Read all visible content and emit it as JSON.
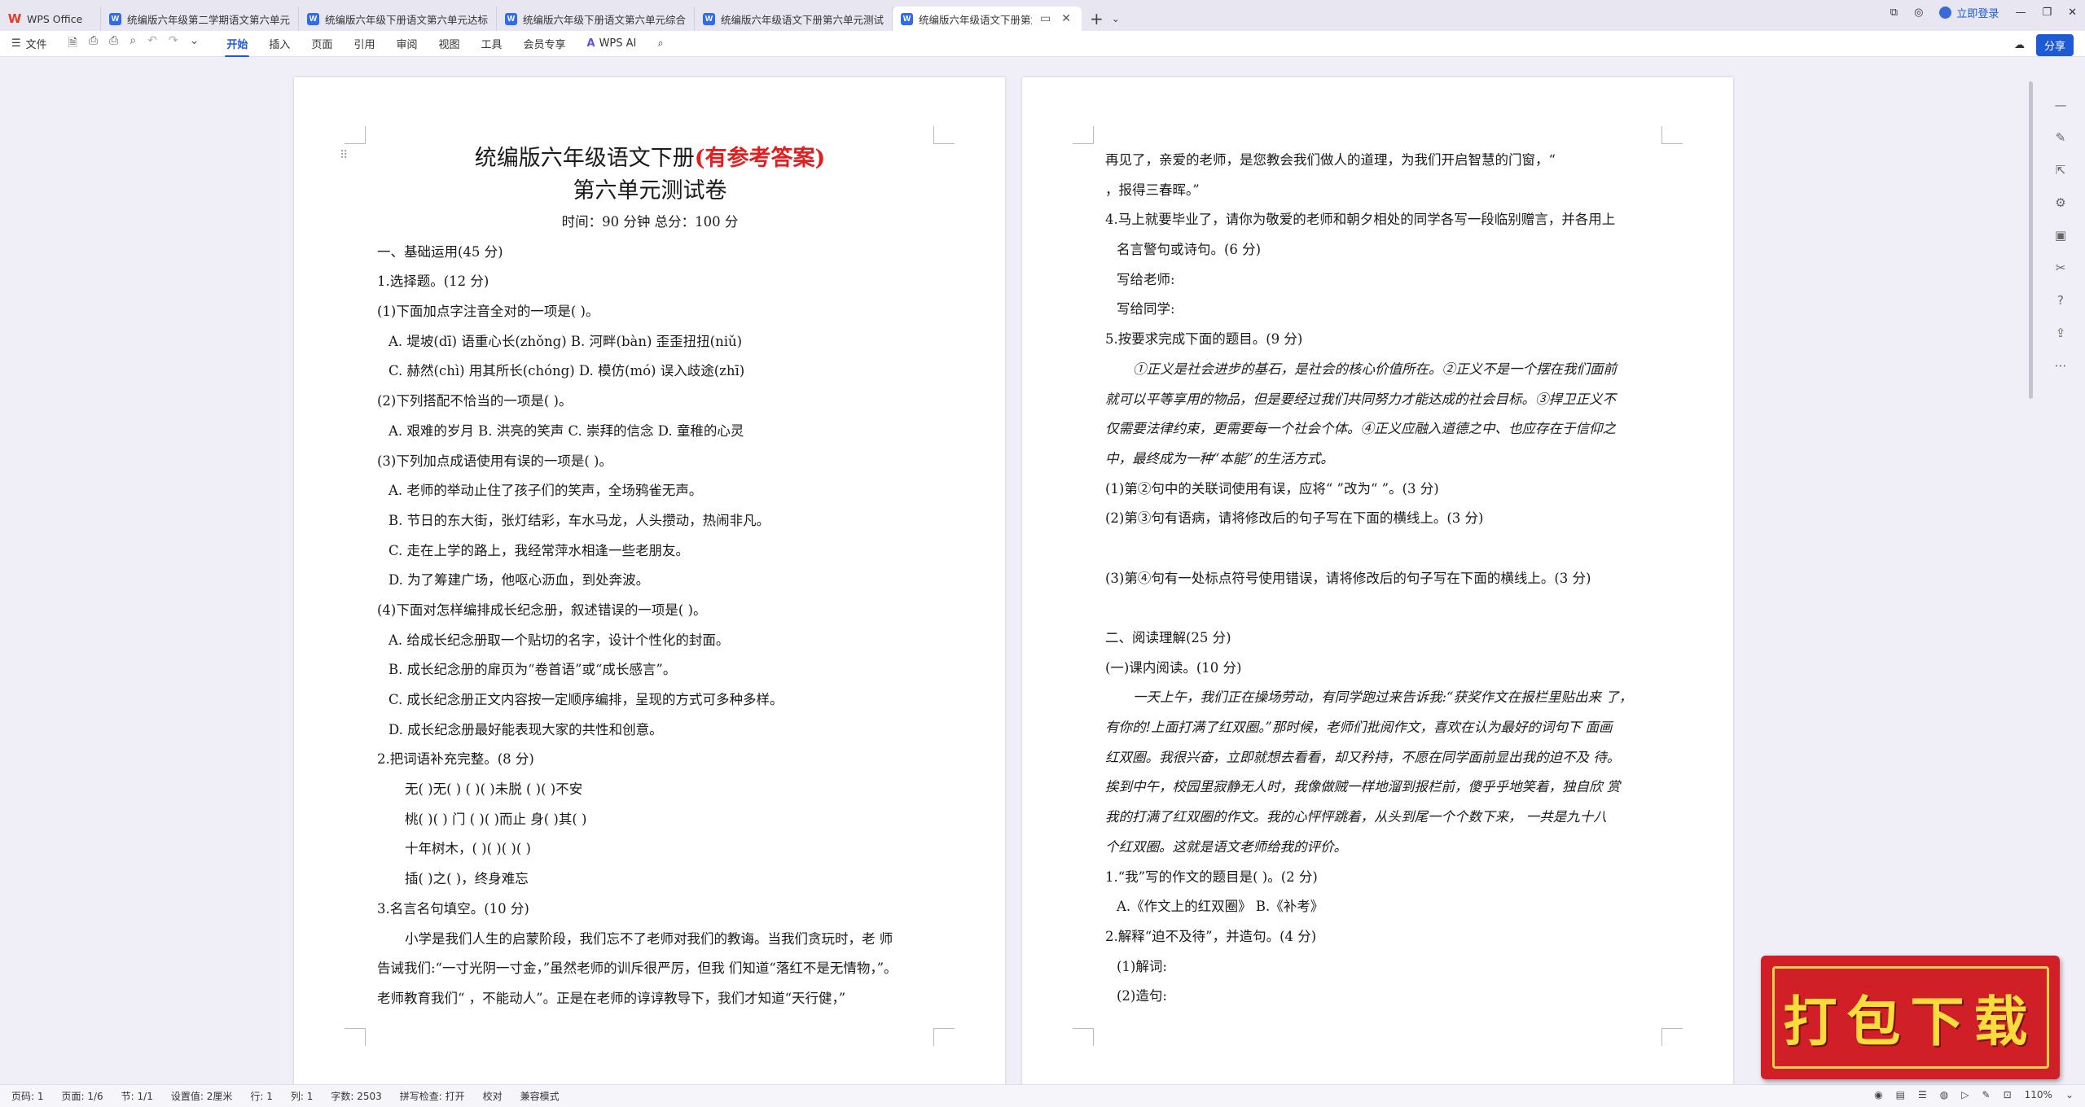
{
  "tabs": {
    "home": "WPS Office",
    "items": [
      "统编版六年级第二学期语文第六单元…",
      "统编版六年级下册语文第六单元达标…",
      "统编版六年级下册语文第六单元综合…",
      "统编版六年级语文下册第六单元测试…",
      "统编版六年级语文下册第六单…"
    ],
    "login": "立即登录"
  },
  "toolbar": {
    "file": "文件",
    "items": [
      "开始",
      "插入",
      "页面",
      "引用",
      "审阅",
      "视图",
      "工具",
      "会员专享"
    ],
    "ai": "WPS AI",
    "share": "分享"
  },
  "page1": {
    "title": "统编版六年级语文下册",
    "title_highlight": "(有参考答案)",
    "subtitle": "第六单元测试卷",
    "time_line": "时间：90 分钟        总分：100 分",
    "lines": [
      "一、基础运用(45 分)",
      "1.选择题。(12 分)",
      "(1)下面加点字注音全对的一项是(        )。",
      "A. 堤坡(dī)        语重心长(zhǒng)            B. 河畔(bàn)       歪歪扭扭(niǔ)",
      "C. 赫然(chì)     用其所长(chóng)            D. 模仿(mó)       误入歧途(zhī)",
      "(2)下列搭配不恰当的一项是(        )。",
      "A. 艰难的岁月          B. 洪亮的笑声          C. 崇拜的信念          D. 童稚的心灵",
      "(3)下列加点成语使用有误的一项是(        )。",
      "A. 老师的举动止住了孩子们的笑声，全场鸦雀无声。",
      "B. 节日的东大街，张灯结彩，车水马龙，人头攒动，热闹非凡。",
      "C. 走在上学的路上，我经常萍水相逢一些老朋友。",
      "D. 为了筹建广场，他呕心沥血，到处奔波。",
      "(4)下面对怎样编排成长纪念册，叙述错误的一项是(        )。",
      "A. 给成长纪念册取一个贴切的名字，设计个性化的封面。",
      "B. 成长纪念册的扉页为“卷首语”或“成长感言”。",
      "C. 成长纪念册正文内容按一定顺序编排，呈现的方式可多种多样。",
      "D. 成长纪念册最好能表现大家的共性和创意。",
      "2.把词语补充完整。(8 分)",
      "无(          )无(          )        (          )(          )未脱        (          )(          )不安",
      "桃(          )(          )  门        (          )(          )而止        身(          )其(          )",
      "十年树木，(          )(          )(          )(          )",
      "插(          )之(          )，终身难忘",
      "3.名言名句填空。(10 分)",
      "小学是我们人生的启蒙阶段，我们忘不了老师对我们的教诲。当我们贪玩时，老  师",
      "告诫我们:“一寸光阴一寸金，”虽然老师的训斥很严厉，但我  们知道“落红不是无情物，”。",
      "老师教育我们“    ，不能动人”。正是在老师的谆谆教导下，我们才知道“天行健，”"
    ]
  },
  "page2": {
    "lines": [
      "再见了，亲爱的老师，是您教会我们做人的道理，为我们开启智慧的门窗，“",
      "，报得三春晖。”",
      "4.马上就要毕业了，请你为敬爱的老师和朝夕相处的同学各写一段临别赠言，并各用上",
      "名言警句或诗句。(6 分)",
      "写给老师:",
      "写给同学:",
      "5.按要求完成下面的题目。(9 分)",
      "①正义是社会进步的基石，是社会的核心价值所在。②正义不是一个摆在我们面前",
      "就可以平等享用的物品，但是要经过我们共同努力才能达成的社会目标。③捍卫正义不",
      "仅需要法律约束，更需要每一个社会个体。④正义应融入道德之中、也应存在于信仰之",
      "中，最终成为一种“本能”的生活方式。",
      "(1)第②句中的关联词使用有误，应将“  ”改为“  ”。(3 分)",
      "(2)第③句有语病，请将修改后的句子写在下面的横线上。(3 分)",
      "",
      "(3)第④句有一处标点符号使用错误，请将修改后的句子写在下面的横线上。(3 分)",
      "",
      "二、阅读理解(25 分)",
      "(一)课内阅读。(10 分)",
      "一天上午，我们正在操场劳动，有同学跑过来告诉我:“获奖作文在报栏里贴出来  了，",
      "有你的!上面打满了红双圈。”那时候，老师们批阅作文，喜欢在认为最好的词句下  面画",
      "红双圈。我很兴奋，立即就想去看看，却又矜持，不愿在同学面前显出我的迫不及  待。",
      "挨到中午，校园里寂静无人时，我像做贼一样地溜到报栏前，傻乎乎地笑着，独自欣  赏",
      "我的打满了红双圈的作文。我的心怦怦跳着，从头到尾一个个数下来，  一共是九十八",
      "个红双圈。这就是语文老师给我的评价。",
      "1.“我”写的作文的题目是(        )。(2 分)",
      "A.《作文上的红双圈》                                              B.《补考》",
      "2.解释“迫不及待”，并造句。(4 分)",
      "(1)解词:",
      "(2)造句:"
    ]
  },
  "statusbar": {
    "items": [
      "页码: 1",
      "页面: 1/6",
      "节: 1/1",
      "设置值: 2厘米",
      "行: 1",
      "列: 1",
      "字数: 2503",
      "拼写检查: 打开",
      "校对",
      "兼容模式"
    ],
    "zoom": "110%"
  },
  "banner": {
    "text": "打包下载"
  },
  "colors": {
    "accent": "#1e5ad6",
    "title_red": "#e02020",
    "banner_red": "#d01f27",
    "banner_yellow": "#f8dd3c"
  }
}
